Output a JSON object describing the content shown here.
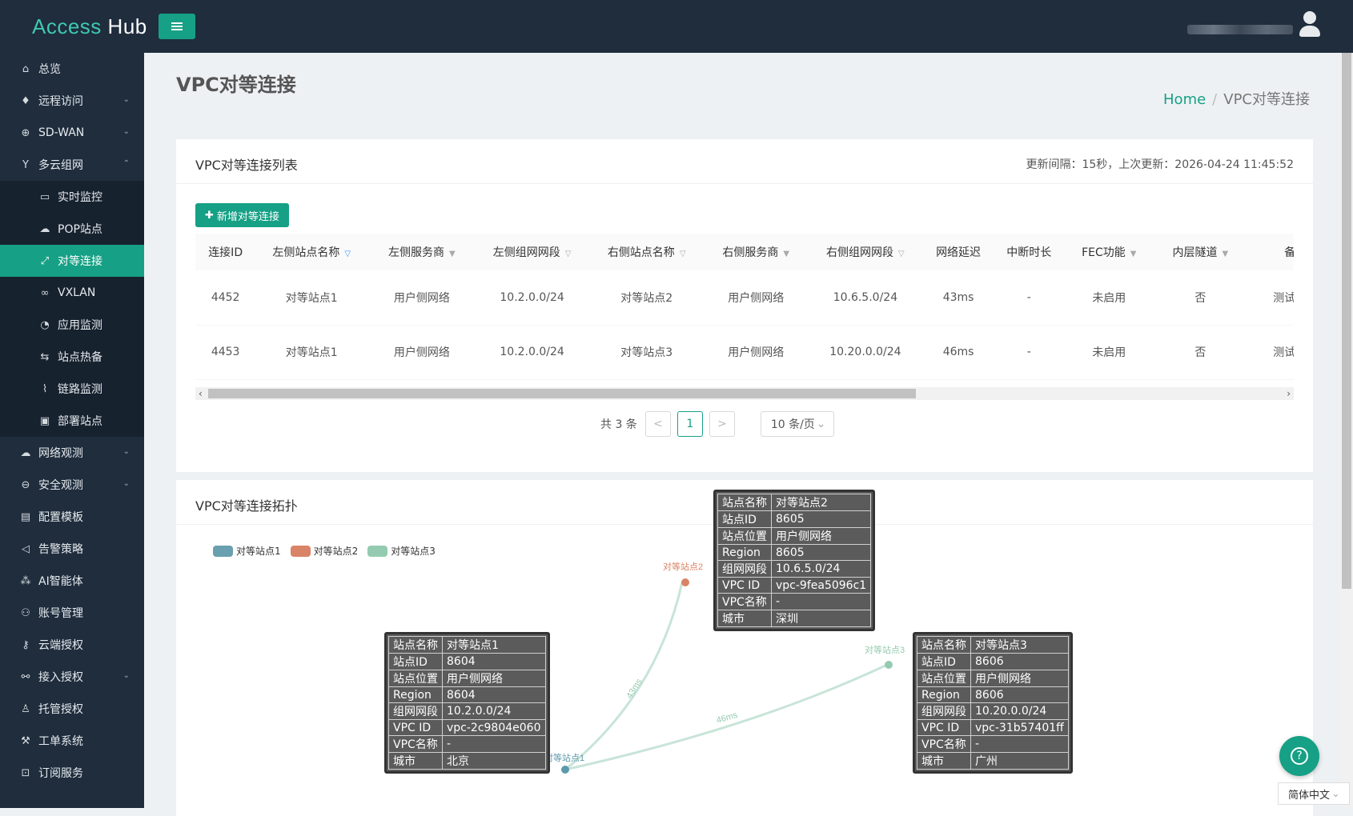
{
  "app": {
    "logo_a": "Access",
    "logo_b": " Hub"
  },
  "sidebar": {
    "items": [
      {
        "label": "总览",
        "icon": "home-icon",
        "glyph": "⌂"
      },
      {
        "label": "远程访问",
        "icon": "rocket-icon",
        "glyph": "♦",
        "chev": "⌄"
      },
      {
        "label": "SD-WAN",
        "icon": "globe-icon",
        "glyph": "⊕",
        "chev": "⌄"
      },
      {
        "label": "多云组网",
        "icon": "fork-icon",
        "glyph": "Y",
        "chev": "⌃"
      }
    ],
    "sub": [
      {
        "label": "实时监控",
        "icon": "monitor-icon",
        "glyph": "▭"
      },
      {
        "label": "POP站点",
        "icon": "cloud-icon",
        "glyph": "☁"
      },
      {
        "label": "对等连接",
        "icon": "link-icon",
        "glyph": "⤢"
      },
      {
        "label": "VXLAN",
        "icon": "chain-icon",
        "glyph": "∞"
      },
      {
        "label": "应用监测",
        "icon": "pie-icon",
        "glyph": "◔"
      },
      {
        "label": "站点热备",
        "icon": "swap-icon",
        "glyph": "⇆"
      },
      {
        "label": "链路监测",
        "icon": "line-chart-icon",
        "glyph": "⌇"
      },
      {
        "label": "部署站点",
        "icon": "box-icon",
        "glyph": "▣"
      }
    ],
    "rest": [
      {
        "label": "网络观测",
        "icon": "cloud-icon",
        "glyph": "☁",
        "chev": "⌄"
      },
      {
        "label": "安全观测",
        "icon": "minus-circle-icon",
        "glyph": "⊖",
        "chev": "⌄"
      },
      {
        "label": "配置模板",
        "icon": "file-icon",
        "glyph": "▤"
      },
      {
        "label": "告警策略",
        "icon": "bell-icon",
        "glyph": "◁"
      },
      {
        "label": "AI智能体",
        "icon": "cluster-icon",
        "glyph": "⁂"
      },
      {
        "label": "账号管理",
        "icon": "user-group-icon",
        "glyph": "⚇"
      },
      {
        "label": "云端授权",
        "icon": "key-icon",
        "glyph": "⚷"
      },
      {
        "label": "接入授权",
        "icon": "link-icon",
        "glyph": "⚯",
        "chev": "⌄"
      },
      {
        "label": "托管授权",
        "icon": "user-icon",
        "glyph": "♙"
      },
      {
        "label": "工单系统",
        "icon": "tool-icon",
        "glyph": "⚒"
      },
      {
        "label": "订阅服务",
        "icon": "cart-icon",
        "glyph": "⊡"
      }
    ]
  },
  "page": {
    "title": "VPC对等连接",
    "crumb_home": "Home",
    "crumb_sep": "/",
    "crumb_current": "VPC对等连接"
  },
  "list_card": {
    "title": "VPC对等连接列表",
    "update_info": "更新间隔：15秒，上次更新：2026-04-24 11:45:52",
    "add_plus": "✚",
    "add_label": "新增对等连接",
    "columns": [
      "连接ID",
      "左侧站点名称",
      "左侧服务商",
      "左侧组网网段",
      "右侧站点名称",
      "右侧服务商",
      "右侧组网网段",
      "网络延迟",
      "中断时长",
      "FEC功能",
      "内层隧道",
      "备"
    ],
    "rows": [
      [
        "4452",
        "对等站点1",
        "用户侧网络",
        "10.2.0.0/24",
        "对等站点2",
        "用户侧网络",
        "10.6.5.0/24",
        "43ms",
        "-",
        "未启用",
        "否",
        "测试对"
      ],
      [
        "4453",
        "对等站点1",
        "用户侧网络",
        "10.2.0.0/24",
        "对等站点3",
        "用户侧网络",
        "10.20.0.0/24",
        "46ms",
        "-",
        "未启用",
        "否",
        "测试对"
      ]
    ],
    "pager": {
      "total": "共 3 条",
      "prev": "<",
      "page": "1",
      "next": ">",
      "size": "10 条/页",
      "size_arrow": "⌄"
    },
    "scroll_left": "‹",
    "scroll_right": "›"
  },
  "topo_card": {
    "title": "VPC对等连接拓扑",
    "legend": [
      {
        "label": "对等站点1",
        "color": "#6a9faf"
      },
      {
        "label": "对等站点2",
        "color": "#d98466"
      },
      {
        "label": "对等站点3",
        "color": "#94cbb0"
      }
    ],
    "nodes": [
      {
        "label": "对等站点1",
        "color": "#5c9aac"
      },
      {
        "label": "对等站点2",
        "color": "#d98466"
      },
      {
        "label": "对等站点3",
        "color": "#94cbb0"
      }
    ],
    "edges": [
      {
        "label": "43ms"
      },
      {
        "label": "46ms"
      }
    ],
    "tooltips": [
      {
        "rows": [
          [
            "站点名称",
            "对等站点2"
          ],
          [
            "站点ID",
            "8605"
          ],
          [
            "站点位置",
            "用户侧网络"
          ],
          [
            "Region",
            "8605"
          ],
          [
            "组网网段",
            "10.6.5.0/24"
          ],
          [
            "VPC ID",
            "vpc-9fea5096c1"
          ],
          [
            "VPC名称",
            "-"
          ],
          [
            "城市",
            "深圳"
          ]
        ]
      },
      {
        "rows": [
          [
            "站点名称",
            "对等站点1"
          ],
          [
            "站点ID",
            "8604"
          ],
          [
            "站点位置",
            "用户侧网络"
          ],
          [
            "Region",
            "8604"
          ],
          [
            "组网网段",
            "10.2.0.0/24"
          ],
          [
            "VPC ID",
            "vpc-2c9804e060"
          ],
          [
            "VPC名称",
            "-"
          ],
          [
            "城市",
            "北京"
          ]
        ]
      },
      {
        "rows": [
          [
            "站点名称",
            "对等站点3"
          ],
          [
            "站点ID",
            "8606"
          ],
          [
            "站点位置",
            "用户侧网络"
          ],
          [
            "Region",
            "8606"
          ],
          [
            "组网网段",
            "10.20.0.0/24"
          ],
          [
            "VPC ID",
            "vpc-31b57401ff"
          ],
          [
            "VPC名称",
            "-"
          ],
          [
            "城市",
            "广州"
          ]
        ]
      }
    ]
  },
  "help_glyph": "?",
  "language": "简体中文",
  "language_arrow": "⌄"
}
